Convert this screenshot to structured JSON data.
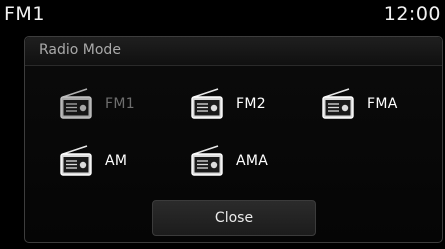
{
  "status_bar": {
    "source": "FM1",
    "clock": "12:00"
  },
  "dialog": {
    "title": "Radio Mode",
    "modes": [
      {
        "label": "FM1",
        "enabled": false,
        "icon": "radio-icon"
      },
      {
        "label": "FM2",
        "enabled": true,
        "icon": "radio-icon"
      },
      {
        "label": "FMA",
        "enabled": true,
        "icon": "radio-icon"
      },
      {
        "label": "AM",
        "enabled": true,
        "icon": "radio-icon"
      },
      {
        "label": "AMA",
        "enabled": true,
        "icon": "radio-icon"
      }
    ],
    "close_label": "Close"
  },
  "colors": {
    "background": "#000000",
    "panel_border": "#3d3d3d",
    "disabled_text": "#6e6e6e",
    "text": "#ffffff"
  }
}
